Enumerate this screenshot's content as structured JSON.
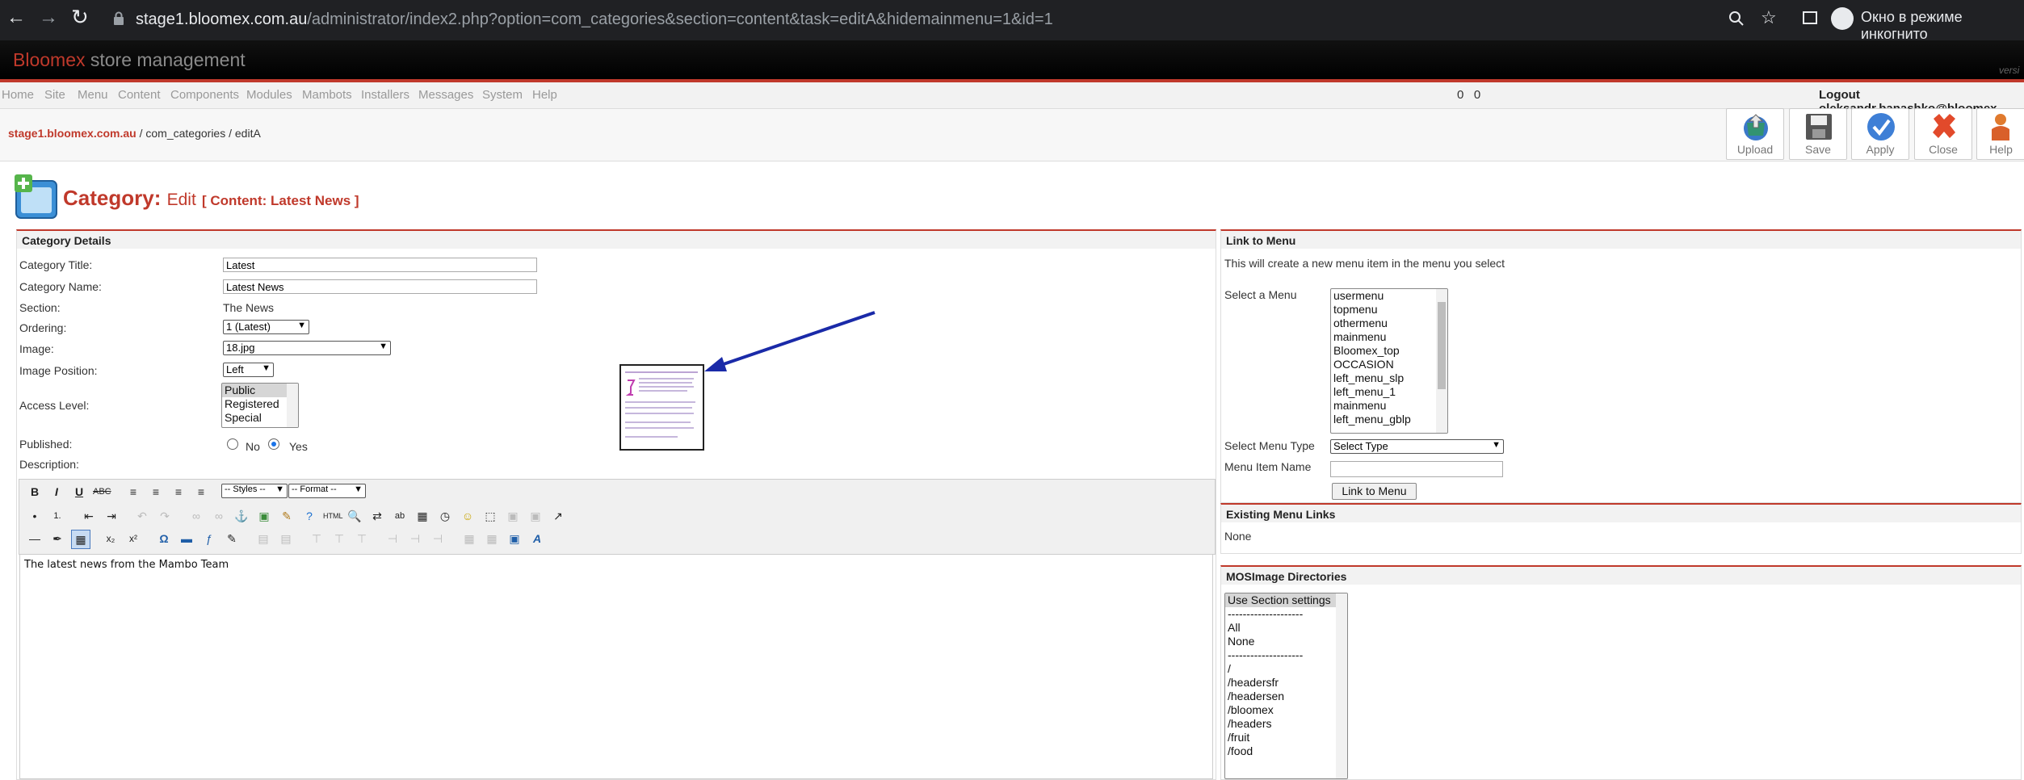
{
  "browser": {
    "url_host": "stage1.bloomex.com.au",
    "url_path": "/administrator/index2.php?option=com_categories&section=content&task=editA&hidemainmenu=1&id=1",
    "incognito_label": "Окно в режиме инкогнито"
  },
  "app": {
    "brand_red": "Bloomex",
    "brand_grey": "store management",
    "version_hint": "versi"
  },
  "menu": {
    "items": [
      "Home",
      "Site",
      "Menu",
      "Content",
      "Components",
      "Modules",
      "Mambots",
      "Installers",
      "Messages",
      "System",
      "Help"
    ],
    "counts": "0   0",
    "logout": "Logout oleksandr.banashko@bloomex"
  },
  "breadcrumb": {
    "site": "stage1.bloomex.com.au",
    "rest": " / com_categories / editA"
  },
  "toolbar": {
    "upload": "Upload",
    "save": "Save",
    "apply": "Apply",
    "close": "Close",
    "help": "Help"
  },
  "page": {
    "title": "Category:",
    "mode": "Edit",
    "context": "[ Content: Latest News ]"
  },
  "details": {
    "heading": "Category Details",
    "title_label": "Category Title:",
    "title_value": "Latest",
    "name_label": "Category Name:",
    "name_value": "Latest News",
    "section_label": "Section:",
    "section_value": "The News",
    "ordering_label": "Ordering:",
    "ordering_value": "1 (Latest)",
    "image_label": "Image:",
    "image_value": "18.jpg",
    "image_position_label": "Image Position:",
    "image_position_value": "Left",
    "access_label": "Access Level:",
    "access_options": [
      "Public",
      "Registered",
      "Special"
    ],
    "published_label": "Published:",
    "published_no": "No",
    "published_yes": "Yes",
    "description_label": "Description:"
  },
  "editor": {
    "styles_select": "-- Styles --",
    "format_select": "-- Format --",
    "content": "The latest news from the Mambo Team"
  },
  "link_menu": {
    "heading": "Link to Menu",
    "description": "This will create a new menu item in the menu you select",
    "select_menu_label": "Select a Menu",
    "menus": [
      "usermenu",
      "topmenu",
      "othermenu",
      "mainmenu",
      "Bloomex_top",
      "OCCASION",
      "left_menu_slp",
      "left_menu_1",
      "mainmenu",
      "left_menu_gblp"
    ],
    "menu_type_label": "Select Menu Type",
    "menu_type_value": "Select Type",
    "item_name_label": "Menu Item Name",
    "link_button": "Link to Menu"
  },
  "existing_links": {
    "heading": "Existing Menu Links",
    "value": "None"
  },
  "mosimage": {
    "heading": "MOSImage Directories",
    "options": [
      "Use Section settings",
      "--------------------",
      "All",
      "None",
      "--------------------",
      "/",
      "/headersfr",
      "/headersen",
      "/bloomex",
      "/headers",
      "/fruit",
      "/food"
    ]
  }
}
